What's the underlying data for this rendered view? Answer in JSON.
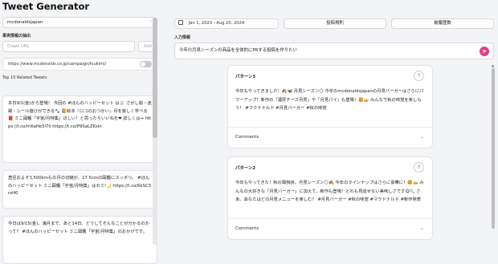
{
  "app": {
    "title": "Tweet Generator"
  },
  "left": {
    "account_select": "mcdonaldsjapan",
    "source_section_label": "事実情報の抽出",
    "crawl_url_placeholder": "Crawl URL",
    "add_label": "Add",
    "source_link": "https://www.mcdonalds.co.jp/campaign/tsukimi/",
    "top_tweets_label": "Top 10 Related Tweets",
    "tweets": [
      "本日9/1(金)から登場！ 今回の #ほんのハッピーセット は🐰 さがし絵・迷路・シール遊びができる🐾 📙絵本『ロコのおつかい』月を楽しく学べる📕 ミニ図鑑「宇宙/月特集」ほしい！と思ったらいいねを❤ 詳しくは→ https://t.co/mKaHe5l7Ii https://t.co/P9SaLZKsIn",
      "直径およそ3,500kmもの月の切継が、17.5cmの図鑑にスッポリ。 #ほんのハッピーセット ミニ図鑑「宇宙/月特集」はセミ!🌙 https://t.co/6kSC3rxH0",
      "今日は9/15(金)。満月まで、あと14日。どうしてそんなことが分かるのかって？ #ほんのハッピーセット ミニ図鑑「宇宙/月特集」のおかげです。"
    ]
  },
  "right": {
    "date_range": "Jan 1, 2023 - Aug 20, 2024",
    "tab_posting_rules": "投稿規則",
    "tab_history": "被履歴数",
    "input_label": "入力情報",
    "input_value": "今年の月見シーズンの商品を全体的にPRする投稿を作りたい",
    "send_icon": "send-icon",
    "patterns": [
      {
        "title": "パターン1",
        "text": "今年もやってきました！🍂🦋 月見シーズン🌕 今年のmcdonaldsjapanの月見バーガーはさらにパワーアップ！新作の「濃厚チーズ月見」や「月見パイ」も登場！🍔🥧 みんなで秋の味覚を楽しもう！ #マクドナルド #月見バーガー #秋の味覚",
        "comments_label": "Comments"
      },
      {
        "title": "パターン2",
        "text": "今年もやってきた！秋の風物詩、月見シーズン🌕🍂 今年のラインナップはさらに豪華に！🍔🥧 みんなの大好きな「月見バーガー」に加えて、新作も登場！どれも見逃せない美味しさです😋🔍 さあ、あなたはどの月見メニューを楽しむ？ #月見バーガー #秋の味覚 #マクドナルド #新作発表",
        "comments_label": "Comments"
      }
    ]
  }
}
